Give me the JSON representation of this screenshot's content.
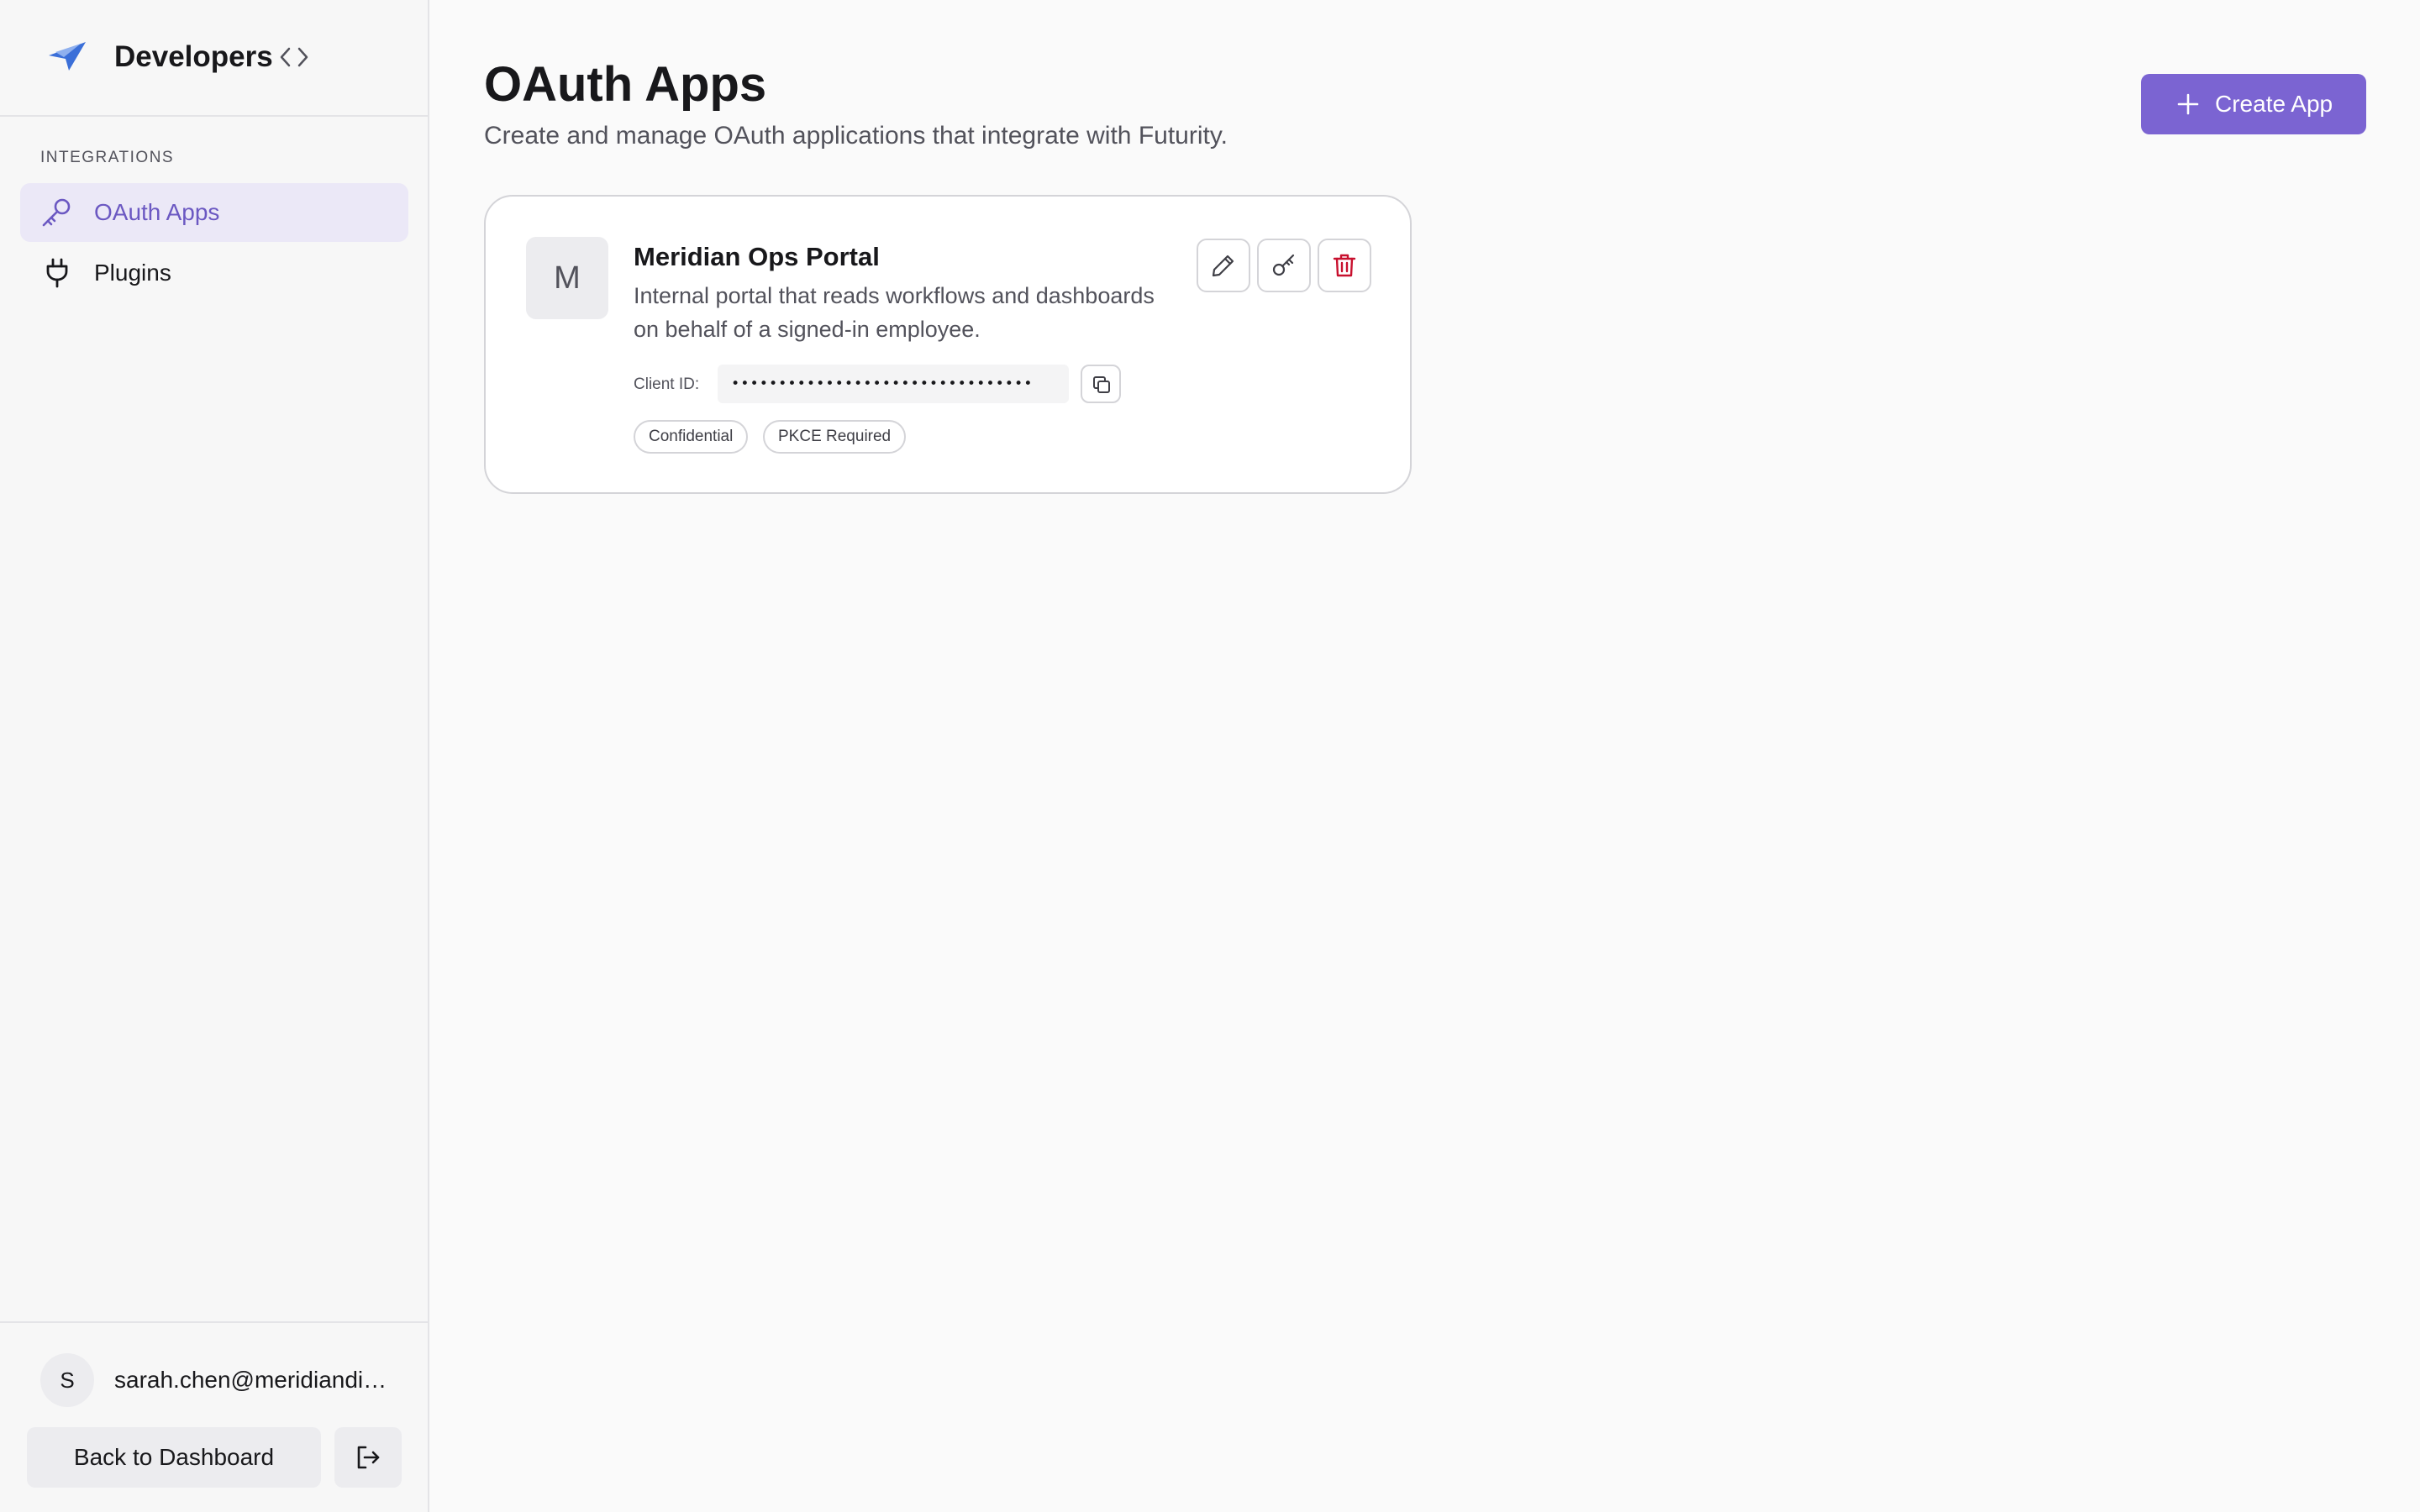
{
  "sidebar": {
    "title": "Developers",
    "section_label": "INTEGRATIONS",
    "items": [
      {
        "label": "OAuth Apps",
        "icon": "key-icon",
        "active": true
      },
      {
        "label": "Plugins",
        "icon": "plug-icon",
        "active": false
      }
    ],
    "user": {
      "avatar_initial": "S",
      "email": "sarah.chen@meridiandi…"
    },
    "back_label": "Back to Dashboard"
  },
  "header": {
    "title": "OAuth Apps",
    "subtitle": "Create and manage OAuth applications that integrate with Futurity.",
    "create_label": "Create App"
  },
  "apps": [
    {
      "initial": "M",
      "name": "Meridian Ops Portal",
      "description": "Internal portal that reads workflows and dashboards on behalf of a signed-in employee.",
      "client_id_label": "Client ID:",
      "client_id_masked": "••••••••••••••••••••••••••••••••",
      "badges": [
        "Confidential",
        "PKCE Required"
      ]
    }
  ],
  "colors": {
    "accent": "#7b64d2",
    "active_nav_bg": "#ebe8f7",
    "danger": "#c8102e",
    "logo_blue": "#3b6fd8"
  }
}
